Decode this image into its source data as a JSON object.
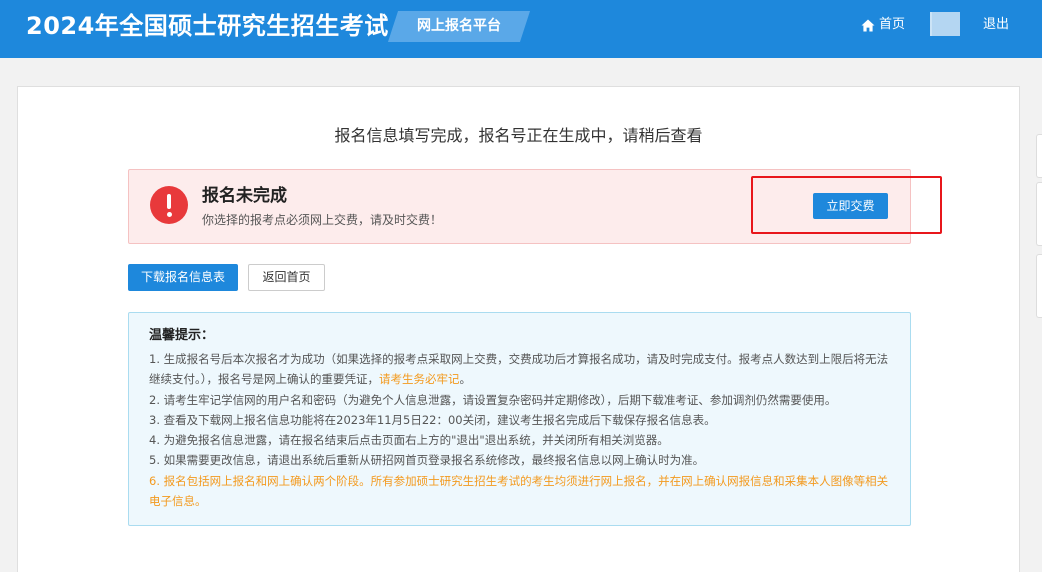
{
  "header": {
    "title": "2024年全国硕士研究生招生考试",
    "platform": "网上报名平台",
    "home_label": "首页",
    "logout_label": "退出"
  },
  "main": {
    "message": "报名信息填写完成，报名号正在生成中，请稍后查看",
    "alert": {
      "title": "报名未完成",
      "subtitle": "你选择的报考点必须网上交费，请及时交费！",
      "pay_label": "立即交费"
    },
    "buttons": {
      "download": "下载报名信息表",
      "back_home": "返回首页"
    },
    "tips": {
      "title": "温馨提示：",
      "item1_text": "1. 生成报名号后本次报名才为成功（如果选择的报考点采取网上交费，交费成功后才算报名成功，请及时完成支付。报考点人数达到上限后将无法继续支付。），报名号是网上确认的重要凭证，",
      "item1_highlight": "请考生务必牢记",
      "item1_end": "。",
      "item2": "2. 请考生牢记学信网的用户名和密码（为避免个人信息泄露，请设置复杂密码并定期修改），后期下载准考证、参加调剂仍然需要使用。",
      "item3": "3. 查看及下载网上报名信息功能将在2023年11月5日22：00关闭，建议考生报名完成后下载保存报名信息表。",
      "item4": "4. 为避免报名信息泄露，请在报名结束后点击页面右上方的\"退出\"退出系统，并关闭所有相关浏览器。",
      "item5": "5. 如果需要更改信息，请退出系统后重新从研招网首页登录报名系统修改，最终报名信息以网上确认时为准。",
      "item6": "6. 报名包括网上报名和网上确认两个阶段。所有参加硕士研究生招生考试的考生均须进行网上报名，并在网上确认网报信息和采集本人图像等相关电子信息。"
    }
  },
  "colors": {
    "primary": "#1e88dc",
    "alert_red": "#e8393b",
    "highlight_orange": "#f39a1f"
  }
}
